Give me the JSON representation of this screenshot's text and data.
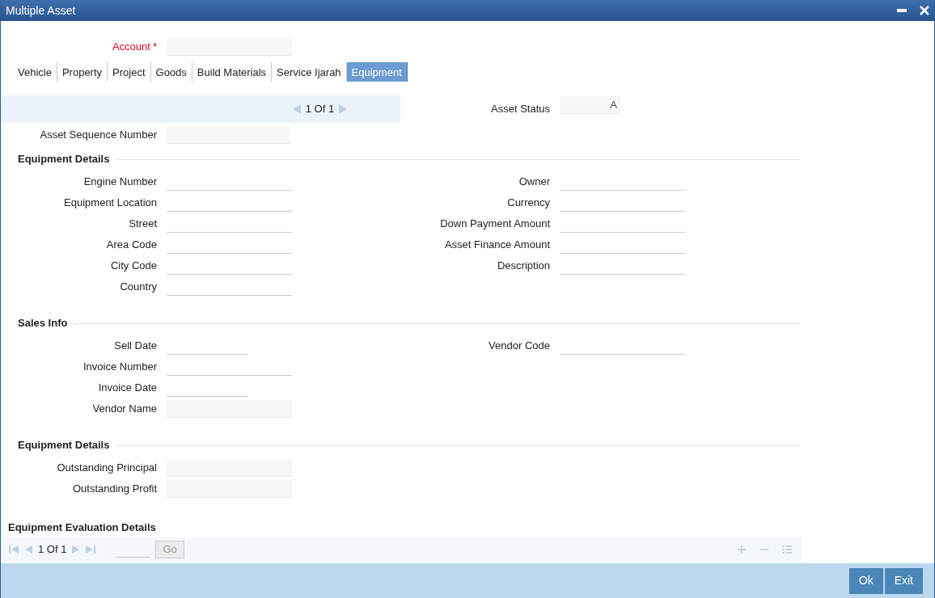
{
  "window": {
    "title": "Multiple Asset"
  },
  "account": {
    "label": "Account",
    "required_mark": "*",
    "disabled": true
  },
  "tabs": [
    {
      "label": "Vehicle",
      "selected": false
    },
    {
      "label": "Property",
      "selected": false
    },
    {
      "label": "Project",
      "selected": false
    },
    {
      "label": "Goods",
      "selected": false
    },
    {
      "label": "Build Materials",
      "selected": false
    },
    {
      "label": "Service Ijarah",
      "selected": false
    },
    {
      "label": "Equipment",
      "selected": true
    }
  ],
  "navigator": {
    "text": "1 Of 1"
  },
  "asset_status": {
    "label": "Asset Status",
    "value": "A",
    "disabled": true
  },
  "asset_sequence": {
    "label": "Asset Sequence Number",
    "disabled": true
  },
  "sections": [
    {
      "title": "Equipment Details",
      "left": [
        {
          "label": "Engine Number",
          "kind": "text",
          "disabled": false
        },
        {
          "label": "Equipment Location",
          "kind": "text",
          "disabled": false
        },
        {
          "label": "Street",
          "kind": "text",
          "disabled": false
        },
        {
          "label": "Area Code",
          "kind": "text",
          "disabled": false
        },
        {
          "label": "City Code",
          "kind": "text",
          "disabled": false
        },
        {
          "label": "Country",
          "kind": "text",
          "disabled": false
        }
      ],
      "right": [
        {
          "label": "Owner",
          "disabled": false
        },
        {
          "label": "Currency",
          "disabled": false
        },
        {
          "label": "Down Payment Amount",
          "disabled": false
        },
        {
          "label": "Asset Finance Amount",
          "disabled": false
        },
        {
          "label": "Description",
          "disabled": false
        }
      ]
    },
    {
      "title": "Sales Info",
      "left": [
        {
          "label": "Sell Date",
          "kind": "date",
          "disabled": false
        },
        {
          "label": "Invoice Number",
          "kind": "text",
          "disabled": false
        },
        {
          "label": "Invoice Date",
          "kind": "date",
          "disabled": false
        },
        {
          "label": "Vendor Name",
          "kind": "text",
          "disabled": true
        }
      ],
      "right": [
        {
          "label": "Vendor Code",
          "disabled": false
        }
      ]
    },
    {
      "title": "Equipment Details",
      "left": [
        {
          "label": "Outstanding Principal",
          "kind": "text",
          "disabled": true
        },
        {
          "label": "Outstanding Profit",
          "kind": "text",
          "disabled": true
        }
      ]
    }
  ],
  "evaluation": {
    "title": "Equipment Evaluation Details",
    "pager": "1 Of 1",
    "go": "Go"
  },
  "buttons": [
    "Ok",
    "Exit"
  ]
}
